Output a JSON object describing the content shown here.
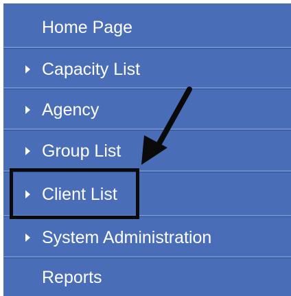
{
  "menu": {
    "items": [
      {
        "label": "Home Page",
        "has_caret": false
      },
      {
        "label": "Capacity List",
        "has_caret": true
      },
      {
        "label": "Agency",
        "has_caret": true
      },
      {
        "label": "Group List",
        "has_caret": true
      },
      {
        "label": "Client List",
        "has_caret": true
      },
      {
        "label": "System Administration",
        "has_caret": true
      },
      {
        "label": "Reports",
        "has_caret": false
      }
    ]
  },
  "colors": {
    "menu_background": "#4a6db8",
    "menu_text": "#ffffff",
    "annotation": "#0a0a0a"
  },
  "annotation": {
    "icon": "arrow-icon",
    "target": "Client List"
  }
}
